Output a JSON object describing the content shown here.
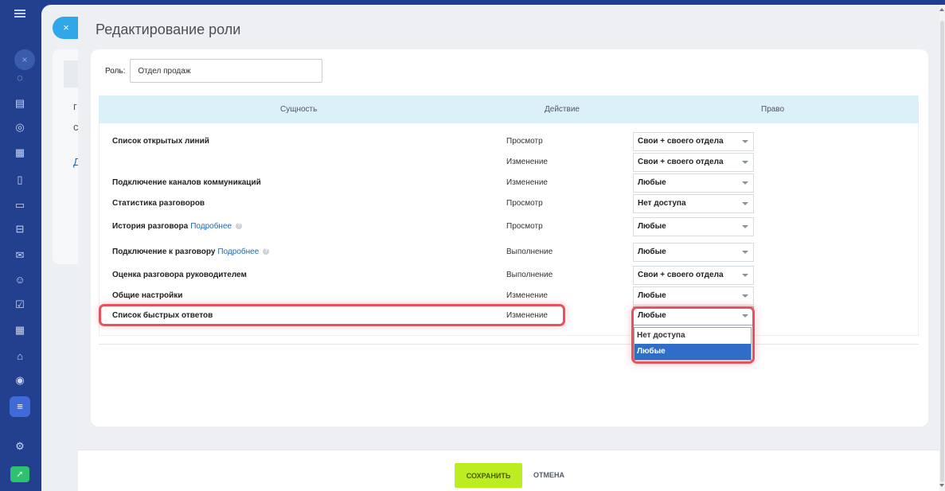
{
  "slider": {
    "title": "Редактирование роли",
    "close_icon": "×"
  },
  "role": {
    "label": "Роль:",
    "value": "Отдел продаж"
  },
  "table": {
    "headers": {
      "entity": "Сущность",
      "action": "Действие",
      "right": "Право"
    },
    "entity_more_link": "Подробнее",
    "rows": [
      {
        "entity": "Список открытых линий",
        "action": "Просмотр",
        "right": "Свои + своего отдела"
      },
      {
        "entity": "",
        "action": "Изменение",
        "right": "Свои + своего отдела"
      },
      {
        "entity": "Подключение каналов коммуникаций",
        "action": "Изменение",
        "right": "Любые"
      },
      {
        "entity": "Статистика разговоров",
        "action": "Просмотр",
        "right": "Нет доступа"
      },
      {
        "entity": "История разговора",
        "action": "Просмотр",
        "right": "Любые"
      },
      {
        "entity": "Подключение к разговору",
        "action": "Выполнение",
        "right": "Любые"
      },
      {
        "entity": "Оценка разговора руководителем",
        "action": "Выполнение",
        "right": "Свои + своего отдела"
      },
      {
        "entity": "Общие настройки",
        "action": "Изменение",
        "right": "Любые"
      },
      {
        "entity": "Список быстрых ответов",
        "action": "Изменение",
        "right": "Любые"
      }
    ]
  },
  "dropdown": {
    "options": [
      "Нет доступа",
      "Любые"
    ],
    "selected": "Любые"
  },
  "footer": {
    "save_label": "СОХРАНИТЬ",
    "cancel_label": "ОТМЕНА"
  },
  "background": {
    "letter_1": "г",
    "letter_2": "с",
    "letter_3": "Д"
  },
  "colors": {
    "accent_blue": "#2fa7e9",
    "save_green": "#bbed21",
    "highlight_red": "#e8525f",
    "selected_option": "#2f6dc8",
    "table_header": "#dcf0fa"
  },
  "icons": [
    "menu-icon",
    "chat-icon",
    "document-icon",
    "settings-icon",
    "calendar-icon",
    "file-icon",
    "monitor-icon",
    "drive-icon",
    "mail-icon",
    "users-icon",
    "tasks-icon",
    "calendar-check-icon",
    "shop-icon",
    "target-icon",
    "filter-icon",
    "gear-icon",
    "rocket-icon"
  ]
}
